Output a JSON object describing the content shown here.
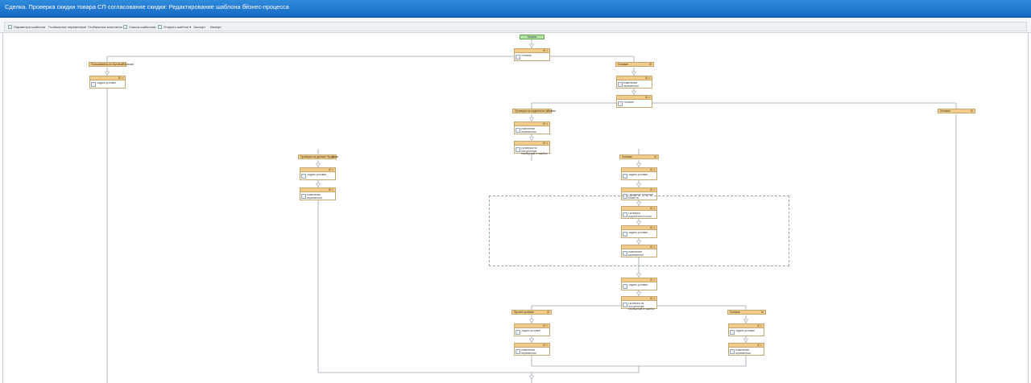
{
  "window": {
    "title": "Сделка. Проверка скидки товара СП согласование скидки: Редактирование шаблона бизнес-процесса"
  },
  "toolbar": {
    "items": [
      {
        "label": "Параметры шаблона"
      },
      {
        "label": "Глобальные переменные"
      },
      {
        "label": "Глобальные константы"
      },
      {
        "label": "Список шаблонов"
      },
      {
        "label": "Открыть шаблон"
      },
      {
        "label": "Экспорт"
      },
      {
        "label": "Импорт"
      }
    ]
  },
  "workflow": {
    "start_label": "Начало",
    "condition_block": {
      "label": "Условие"
    },
    "left_branch": {
      "label": "Пользователь не Коллега Пользов",
      "block": "Задать условие"
    },
    "right_branch": {
      "label": "Условие",
      "block": "Изменение переменных"
    },
    "right_condition": {
      "label": "Условие"
    },
    "sub_left_branch": {
      "label": "Проверка на корректное условие",
      "blocks": [
        "Изменение переменных",
        "Проверка на поступление сообщений и ошибок"
      ]
    },
    "sub_right_branch": {
      "label": "Условие"
    },
    "mid_left_branch": {
      "label": "Проверка на данные Продажа",
      "blocks": [
        "Задать условие",
        "Изменение переменных"
      ]
    },
    "mid_center_branch": {
      "label": "Условие",
      "blocks": [
        "Задать условие",
        "Ожидание Решения Клиента"
      ]
    },
    "loop_blocks": [
      "Проверка корректности поля",
      "Задать условие",
      "Изменение переменных"
    ],
    "post_loop_blocks": [
      "Задать условие",
      "Проверка на поступление сообщений и ошибок"
    ],
    "bottom_left_branch": {
      "label": "Прочее условие",
      "blocks": [
        "Задать условие",
        "Изменение переменных"
      ]
    },
    "bottom_right_branch": {
      "label": "Условие",
      "blocks": [
        "Задать условие",
        "Изменение переменных"
      ]
    }
  }
}
